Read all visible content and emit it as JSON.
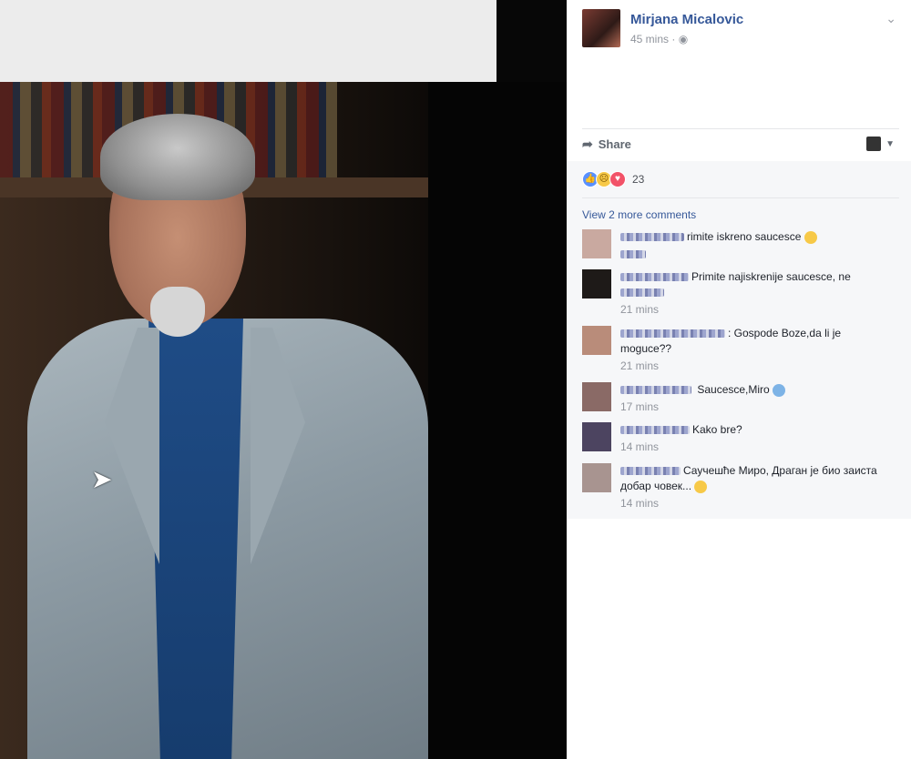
{
  "post": {
    "author": "Mirjana Micalovic",
    "time": "45 mins ·",
    "privacy_icon": "globe-icon",
    "share_label": "Share",
    "reaction_count": "23",
    "reaction_icons": [
      "like-icon",
      "sad-icon",
      "love-icon"
    ],
    "view_more": "View 2 more comments"
  },
  "comments": [
    {
      "text": "rimite iskreno saucesce",
      "time": "",
      "emoji": "sad"
    },
    {
      "text": "Primite najiskrenije saucesce, ne",
      "time": "21 mins",
      "emoji": ""
    },
    {
      "text": ": Gospode Boze,da li je moguce??",
      "time": "21 mins",
      "emoji": ""
    },
    {
      "text": "Saucesce,Miro",
      "time": "17 mins",
      "emoji": "fearful"
    },
    {
      "text": "Kako bre?",
      "time": "14 mins",
      "emoji": ""
    },
    {
      "text": "Саучешће Миро, Драган је био заиста добар човек...",
      "time": "14 mins",
      "emoji": "sad"
    }
  ],
  "colors": {
    "link": "#365899",
    "meta": "#90949c",
    "panel_bg": "#f6f7f9"
  }
}
